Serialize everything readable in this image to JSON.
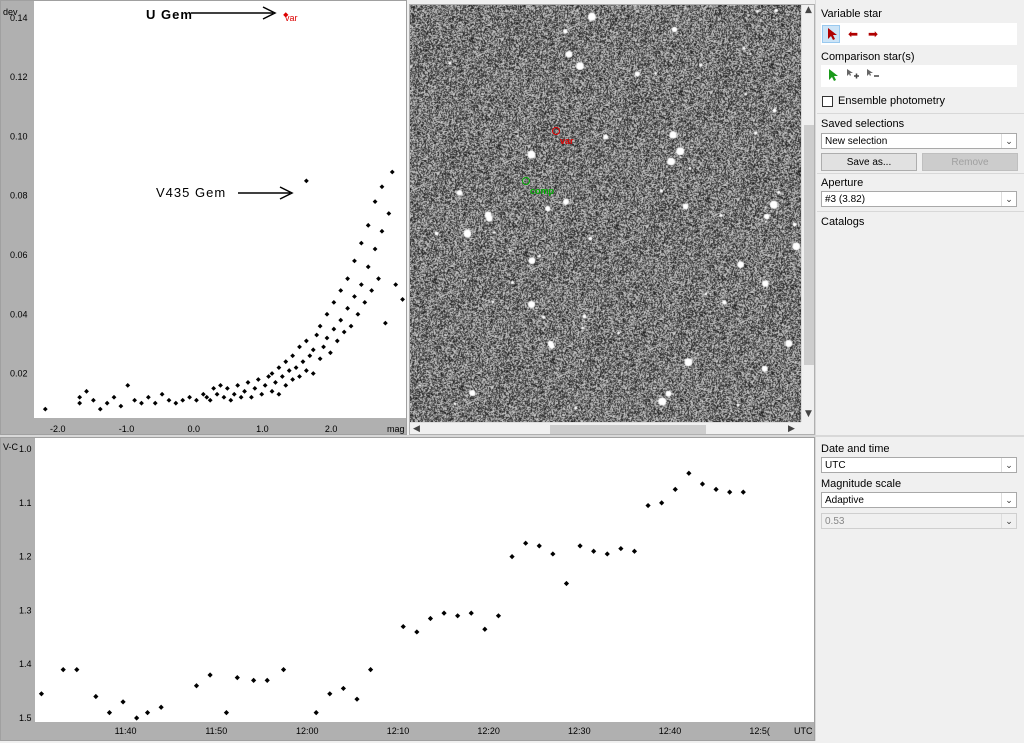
{
  "scatter": {
    "y_axis_label": "dev",
    "x_axis_label": "mag",
    "y_ticks": [
      "0.14",
      "0.12",
      "0.10",
      "0.08",
      "0.06",
      "0.04",
      "0.02"
    ],
    "x_ticks": [
      "-2.0",
      "-1.0",
      "0.0",
      "1.0",
      "2.0"
    ],
    "annot_ugem": "U Gem",
    "annot_v435": "V435 Gem",
    "var_label": "var"
  },
  "image": {
    "var_label": "var",
    "comp_label": "comp"
  },
  "curve": {
    "y_axis_label": "V-C",
    "y_ticks": [
      "1.0",
      "1.1",
      "1.2",
      "1.3",
      "1.4",
      "1.5"
    ],
    "x_ticks": [
      "11:40",
      "11:50",
      "12:00",
      "12:10",
      "12:20",
      "12:30",
      "12:40",
      "12:5("
    ],
    "x_unit": "UTC"
  },
  "side": {
    "variable_star": "Variable star",
    "comparison_stars": "Comparison star(s)",
    "ensemble": "Ensemble photometry",
    "saved_selections": "Saved selections",
    "saved_value": "New selection",
    "save_as": "Save as...",
    "remove": "Remove",
    "aperture": "Aperture",
    "aperture_value": "#3 (3.82)",
    "catalogs": "Catalogs",
    "date_time": "Date and time",
    "date_value": "UTC",
    "mag_scale": "Magnitude scale",
    "mag_value": "Adaptive",
    "mag_extra": "0.53"
  },
  "colors": {
    "var": "#dd0000",
    "comp": "#00aa00"
  },
  "chart_data": [
    {
      "type": "scatter",
      "xlabel": "mag",
      "ylabel": "dev",
      "xlim": [
        -2.35,
        3.05
      ],
      "ylim": [
        0.005,
        0.145
      ],
      "highlight": [
        {
          "label": "var",
          "x": 1.3,
          "y": 0.141
        },
        {
          "x": 1.6,
          "y": 0.085
        }
      ],
      "points": [
        [
          -2.2,
          0.008
        ],
        [
          -1.7,
          0.01
        ],
        [
          -1.7,
          0.012
        ],
        [
          -1.6,
          0.014
        ],
        [
          -1.5,
          0.011
        ],
        [
          -1.4,
          0.008
        ],
        [
          -1.3,
          0.01
        ],
        [
          -1.2,
          0.012
        ],
        [
          -1.1,
          0.009
        ],
        [
          -1.0,
          0.016
        ],
        [
          -0.9,
          0.011
        ],
        [
          -0.8,
          0.01
        ],
        [
          -0.7,
          0.012
        ],
        [
          -0.6,
          0.01
        ],
        [
          -0.5,
          0.013
        ],
        [
          -0.4,
          0.011
        ],
        [
          -0.3,
          0.01
        ],
        [
          -0.2,
          0.011
        ],
        [
          -0.1,
          0.012
        ],
        [
          0.0,
          0.011
        ],
        [
          0.1,
          0.013
        ],
        [
          0.15,
          0.012
        ],
        [
          0.2,
          0.011
        ],
        [
          0.25,
          0.015
        ],
        [
          0.3,
          0.013
        ],
        [
          0.35,
          0.016
        ],
        [
          0.4,
          0.012
        ],
        [
          0.45,
          0.015
        ],
        [
          0.5,
          0.011
        ],
        [
          0.55,
          0.013
        ],
        [
          0.6,
          0.016
        ],
        [
          0.65,
          0.012
        ],
        [
          0.7,
          0.014
        ],
        [
          0.75,
          0.017
        ],
        [
          0.8,
          0.012
        ],
        [
          0.85,
          0.015
        ],
        [
          0.9,
          0.018
        ],
        [
          0.95,
          0.013
        ],
        [
          1.0,
          0.016
        ],
        [
          1.05,
          0.019
        ],
        [
          1.1,
          0.014
        ],
        [
          1.1,
          0.02
        ],
        [
          1.15,
          0.017
        ],
        [
          1.2,
          0.022
        ],
        [
          1.2,
          0.013
        ],
        [
          1.25,
          0.019
        ],
        [
          1.3,
          0.024
        ],
        [
          1.3,
          0.016
        ],
        [
          1.35,
          0.021
        ],
        [
          1.4,
          0.018
        ],
        [
          1.4,
          0.026
        ],
        [
          1.45,
          0.022
        ],
        [
          1.5,
          0.029
        ],
        [
          1.5,
          0.019
        ],
        [
          1.55,
          0.024
        ],
        [
          1.6,
          0.021
        ],
        [
          1.6,
          0.031
        ],
        [
          1.65,
          0.026
        ],
        [
          1.7,
          0.028
        ],
        [
          1.7,
          0.02
        ],
        [
          1.75,
          0.033
        ],
        [
          1.8,
          0.025
        ],
        [
          1.8,
          0.036
        ],
        [
          1.85,
          0.029
        ],
        [
          1.9,
          0.032
        ],
        [
          1.9,
          0.04
        ],
        [
          1.95,
          0.027
        ],
        [
          2.0,
          0.035
        ],
        [
          2.0,
          0.044
        ],
        [
          2.05,
          0.031
        ],
        [
          2.1,
          0.038
        ],
        [
          2.1,
          0.048
        ],
        [
          2.15,
          0.034
        ],
        [
          2.2,
          0.042
        ],
        [
          2.2,
          0.052
        ],
        [
          2.25,
          0.036
        ],
        [
          2.3,
          0.046
        ],
        [
          2.3,
          0.058
        ],
        [
          2.35,
          0.04
        ],
        [
          2.4,
          0.05
        ],
        [
          2.4,
          0.064
        ],
        [
          2.45,
          0.044
        ],
        [
          2.5,
          0.056
        ],
        [
          2.5,
          0.07
        ],
        [
          2.55,
          0.048
        ],
        [
          2.6,
          0.062
        ],
        [
          2.6,
          0.078
        ],
        [
          2.65,
          0.052
        ],
        [
          2.7,
          0.068
        ],
        [
          2.7,
          0.083
        ],
        [
          2.75,
          0.037
        ],
        [
          2.8,
          0.074
        ],
        [
          2.85,
          0.088
        ],
        [
          2.9,
          0.05
        ],
        [
          3.0,
          0.045
        ]
      ]
    },
    {
      "type": "scatter",
      "xlabel": "",
      "ylabel": "V-C",
      "xlim": [
        11.5,
        12.93
      ],
      "ylim": [
        1.5,
        0.985
      ],
      "x_unit": "hours UTC",
      "points": [
        [
          11.51,
          1.455
        ],
        [
          11.55,
          1.41
        ],
        [
          11.575,
          1.41
        ],
        [
          11.61,
          1.46
        ],
        [
          11.635,
          1.49
        ],
        [
          11.66,
          1.47
        ],
        [
          11.685,
          1.5
        ],
        [
          11.705,
          1.49
        ],
        [
          11.73,
          1.48
        ],
        [
          11.795,
          1.44
        ],
        [
          11.82,
          1.42
        ],
        [
          11.85,
          1.49
        ],
        [
          11.87,
          1.425
        ],
        [
          11.9,
          1.43
        ],
        [
          11.925,
          1.43
        ],
        [
          11.955,
          1.41
        ],
        [
          12.015,
          1.49
        ],
        [
          12.04,
          1.455
        ],
        [
          12.065,
          1.445
        ],
        [
          12.09,
          1.465
        ],
        [
          12.115,
          1.41
        ],
        [
          12.175,
          1.33
        ],
        [
          12.2,
          1.34
        ],
        [
          12.225,
          1.315
        ],
        [
          12.25,
          1.305
        ],
        [
          12.275,
          1.31
        ],
        [
          12.3,
          1.305
        ],
        [
          12.325,
          1.335
        ],
        [
          12.35,
          1.31
        ],
        [
          12.375,
          1.2
        ],
        [
          12.4,
          1.175
        ],
        [
          12.425,
          1.18
        ],
        [
          12.45,
          1.195
        ],
        [
          12.475,
          1.25
        ],
        [
          12.5,
          1.18
        ],
        [
          12.525,
          1.19
        ],
        [
          12.55,
          1.195
        ],
        [
          12.575,
          1.185
        ],
        [
          12.6,
          1.19
        ],
        [
          12.625,
          1.105
        ],
        [
          12.65,
          1.1
        ],
        [
          12.675,
          1.075
        ],
        [
          12.7,
          1.045
        ],
        [
          12.725,
          1.065
        ],
        [
          12.75,
          1.075
        ],
        [
          12.775,
          1.08
        ],
        [
          12.8,
          1.08
        ]
      ]
    }
  ]
}
